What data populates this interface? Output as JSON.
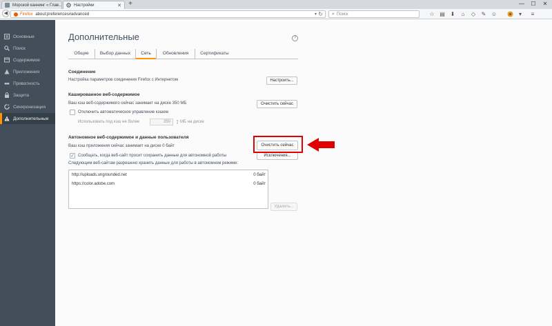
{
  "browser": {
    "tabs": [
      {
        "title": "Морской каннинг « Глав..."
      },
      {
        "title": "Настройки"
      }
    ],
    "new_tab": "+",
    "window_controls": {
      "minimize": "—",
      "maximize": "☐",
      "close": "✕"
    },
    "url_brand": "Firefox",
    "url": "about:preferences#advanced",
    "search_placeholder": "Поиск",
    "toolbar_icons": [
      "bookmark-star-icon",
      "reading-list-icon",
      "download-icon",
      "home-icon",
      "pocket-icon",
      "wrench-icon",
      "emoji-icon",
      "addon-icon",
      "menu-icon"
    ]
  },
  "sidebar": {
    "items": [
      {
        "label": "Основные",
        "icon": "general-icon"
      },
      {
        "label": "Поиск",
        "icon": "search-icon"
      },
      {
        "label": "Содержимое",
        "icon": "content-icon"
      },
      {
        "label": "Приложения",
        "icon": "applications-icon"
      },
      {
        "label": "Приватность",
        "icon": "privacy-icon"
      },
      {
        "label": "Защита",
        "icon": "security-icon"
      },
      {
        "label": "Синхронизация",
        "icon": "sync-icon"
      },
      {
        "label": "Дополнительные",
        "icon": "advanced-icon"
      }
    ],
    "active_index": 7
  },
  "page": {
    "title": "Дополнительные",
    "help": "?",
    "tabs": [
      "Общие",
      "Выбор данных",
      "Сеть",
      "Обновления",
      "Сертификаты"
    ],
    "selected_tab": "Сеть"
  },
  "connection": {
    "title": "Соединение",
    "desc": "Настройка параметров соединения Firefox с Интернетом",
    "button": "Настроить..."
  },
  "cache": {
    "title": "Кашированное веб-содержимое",
    "desc": "Ваш кэш веб-содержимого сейчас занимает на диске 350 МБ",
    "button": "Очистить сейчас",
    "override_label": "Отключить автоматическое управление кэшем",
    "override_checked": false,
    "limit_prefix": "Использовать под кэш не более",
    "limit_value": "350",
    "limit_suffix": "МБ на диске"
  },
  "offline": {
    "title": "Автономное веб-содержимое и данные пользователя",
    "desc": "Ваш кэш приложения сейчас занимает на диске 0 байт",
    "clear_button": "Очистить сейчас",
    "exceptions_button": "Исключения...",
    "notify_label": "Сообщать, когда веб-сайт просит сохранить данные для автономной работы",
    "notify_checked": true,
    "list_caption": "Следующим веб-сайтам разрешено хранить данные для работы в автономном режиме:",
    "sites": [
      {
        "url": "http://uploads.ungrounded.net",
        "size": "0 байт"
      },
      {
        "url": "https://color.adobe.com",
        "size": "0 байт"
      }
    ],
    "remove_button": "Удалить..."
  },
  "colors": {
    "accent": "#ff9500",
    "sidebar_bg": "#424f5a",
    "annotation_red": "#e00000"
  }
}
